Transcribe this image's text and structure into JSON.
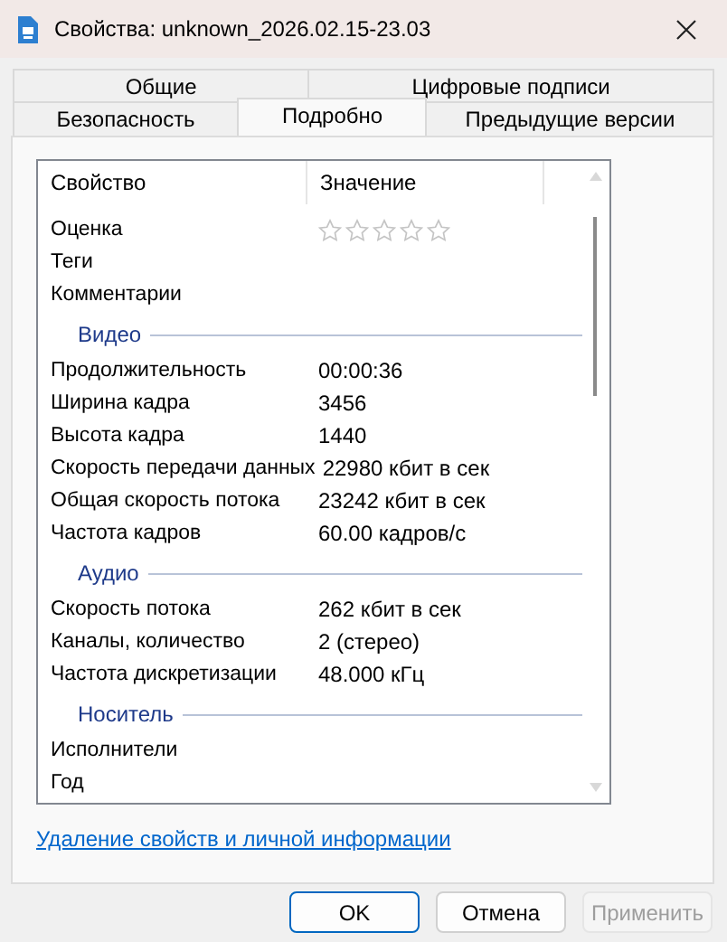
{
  "window": {
    "title": "Свойства: unknown_2026.02.15-23.03"
  },
  "tab_rows": [
    [
      {
        "label": "Общие",
        "selected": false
      },
      {
        "label": "Цифровые подписи",
        "selected": false
      }
    ],
    [
      {
        "label": "Безопасность",
        "selected": false
      },
      {
        "label": "Подробно",
        "selected": true
      },
      {
        "label": "Предыдущие версии",
        "selected": false
      }
    ]
  ],
  "table": {
    "columns": [
      "Свойство",
      "Значение"
    ],
    "rows": [
      {
        "kind": "rating",
        "name": "Оценка",
        "stars": 0
      },
      {
        "kind": "property",
        "name": "Теги"
      },
      {
        "kind": "property",
        "name": "Комментарии"
      },
      {
        "kind": "group",
        "name": "Видео"
      },
      {
        "kind": "property",
        "name": "Продолжительность",
        "value": "00:00:36"
      },
      {
        "kind": "property",
        "name": "Ширина кадра",
        "value": "3456"
      },
      {
        "kind": "property",
        "name": "Высота кадра",
        "value": "1440"
      },
      {
        "kind": "property",
        "name": "Скорость передачи данных",
        "value": "22980 кбит в сек"
      },
      {
        "kind": "property",
        "name": "Общая скорость потока",
        "value": "23242 кбит в сек"
      },
      {
        "kind": "property",
        "name": "Частота кадров",
        "value": "60.00 кадров/с"
      },
      {
        "kind": "group",
        "name": "Аудио"
      },
      {
        "kind": "property",
        "name": "Скорость потока",
        "value": "262 кбит в сек"
      },
      {
        "kind": "property",
        "name": "Каналы, количество",
        "value": "2 (стерео)"
      },
      {
        "kind": "property",
        "name": "Частота дискретизации",
        "value": "48.000 кГц"
      },
      {
        "kind": "group",
        "name": "Носитель"
      },
      {
        "kind": "property",
        "name": "Исполнители"
      },
      {
        "kind": "property",
        "name": "Год"
      }
    ]
  },
  "link": "Удаление свойств и личной информации",
  "buttons": [
    {
      "label": "OK",
      "kind": "default",
      "disabled": false
    },
    {
      "label": "Отмена",
      "kind": "normal",
      "disabled": false
    },
    {
      "label": "Применить",
      "kind": "normal",
      "disabled": true
    }
  ]
}
